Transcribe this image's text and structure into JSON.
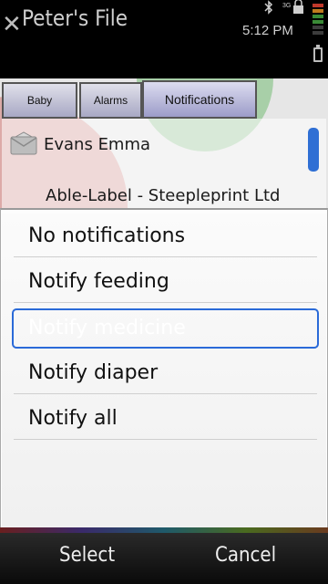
{
  "statusbar": {
    "title": "Peter's File",
    "clock": "5:12 PM",
    "lock_label": "3G",
    "icons": [
      "close-icon",
      "bluetooth-icon",
      "lock-icon",
      "signal-icon",
      "battery-icon"
    ]
  },
  "tabs": [
    {
      "label": "Baby"
    },
    {
      "label": "Alarms"
    },
    {
      "label": "Notifications",
      "active": true
    }
  ],
  "list": {
    "contact_name": "Evans Emma",
    "organization": "Able-Label - Steepleprint Ltd"
  },
  "popup": {
    "options": [
      {
        "label": "No notifications"
      },
      {
        "label": "Notify feeding"
      },
      {
        "label": "Notify medicine",
        "selected": true
      },
      {
        "label": "Notify diaper"
      },
      {
        "label": "Notify all"
      }
    ]
  },
  "softkeys": {
    "left": "Select",
    "right": "Cancel"
  },
  "colors": {
    "selection_border": "#2a6ad8",
    "scroll_thumb": "#2f6fd4",
    "tab_active": "#9c9cc8"
  }
}
